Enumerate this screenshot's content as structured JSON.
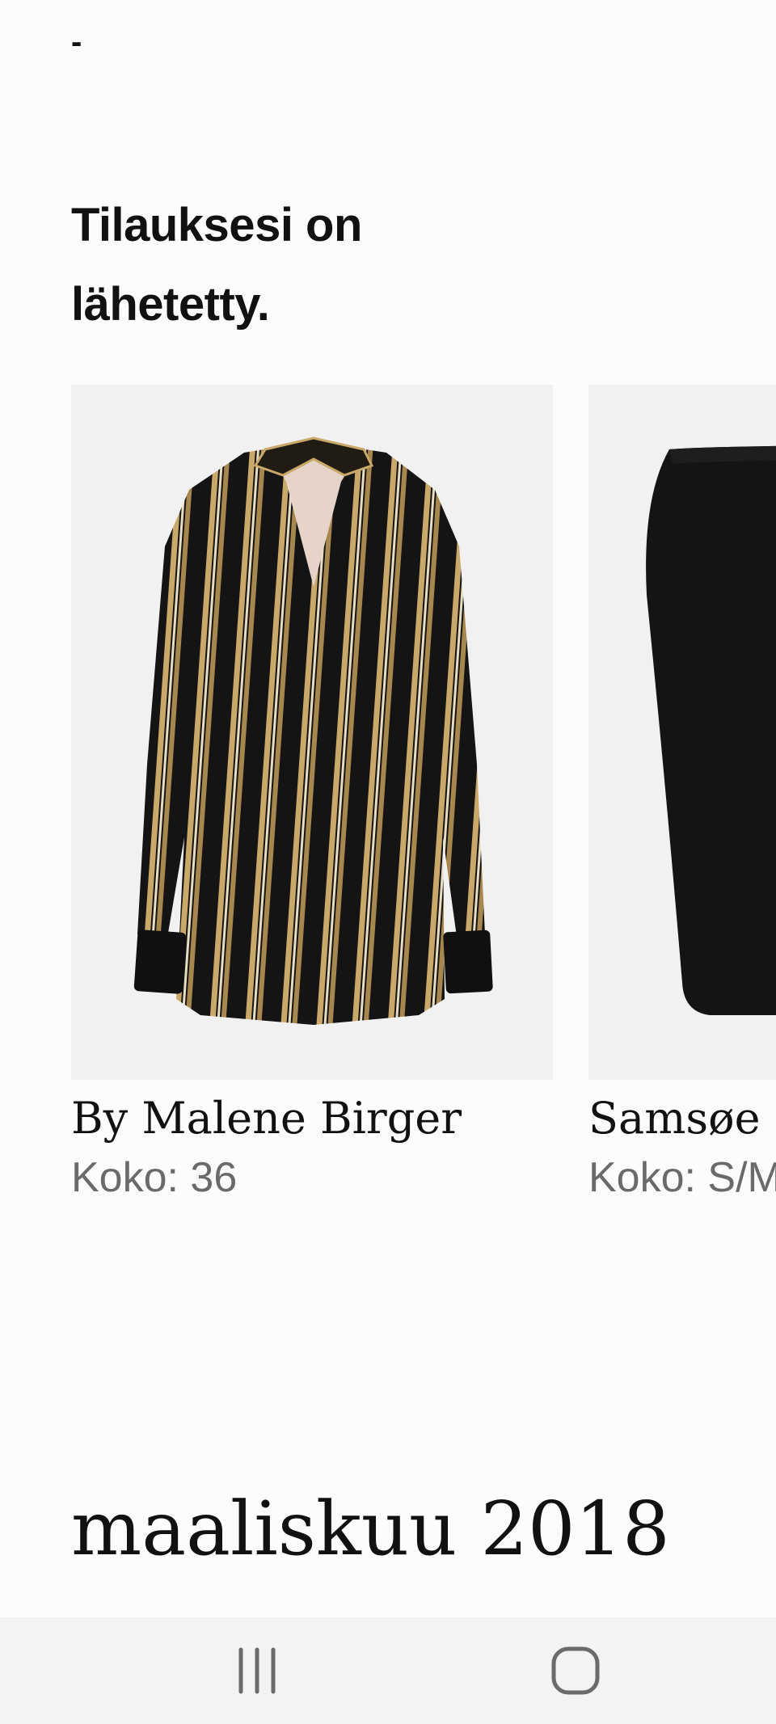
{
  "header": {
    "dash": "-"
  },
  "order": {
    "status_title": "Tilauksesi on lähetetty."
  },
  "products": [
    {
      "brand": "By Malene Birger",
      "size": "Koko: 36",
      "image_icon": "striped-blouse-image"
    },
    {
      "brand": "Samsøe Samsøe",
      "size": "Koko: S/M",
      "image_icon": "black-skirt-image"
    }
  ],
  "history": {
    "month_heading": "maaliskuu 2018"
  },
  "navigation": {
    "recents_icon": "recent-apps-icon",
    "home_icon": "home-icon"
  },
  "colors": {
    "background": "#fcfcfd",
    "image_background": "#f1f1f1",
    "secondary_text": "#6a6a6a",
    "nav_bar": "#f3f3f5"
  }
}
